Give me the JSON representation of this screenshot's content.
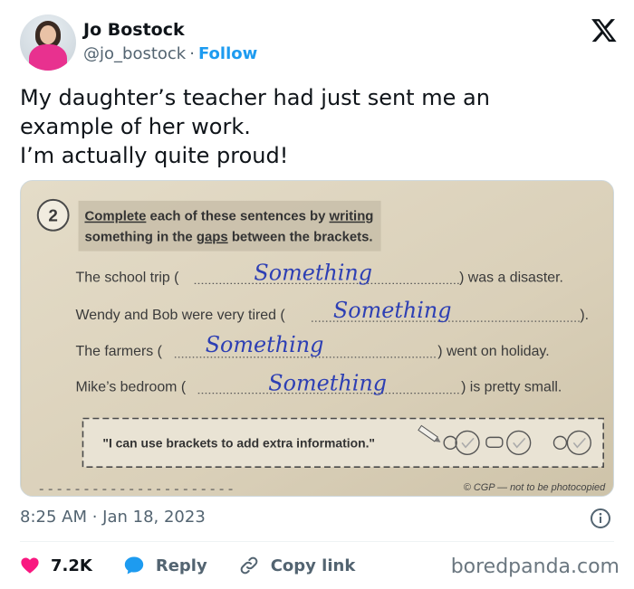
{
  "author": {
    "name": "Jo Bostock",
    "handle": "@jo_bostock",
    "separator": "·",
    "follow_label": "Follow"
  },
  "tweet": {
    "lines": [
      "My daughter’s teacher had just sent me an",
      "example of her work.",
      "I’m actually quite proud!"
    ]
  },
  "worksheet": {
    "number": "2",
    "instruction_line1_a": "Complete",
    "instruction_line1_b": " each of these sentences by ",
    "instruction_line1_c": "writing",
    "instruction_line2_a": "something in the ",
    "instruction_line2_b": "gaps",
    "instruction_line2_c": " between the brackets.",
    "sentences": [
      {
        "before": "The school trip (",
        "fill": "Something",
        "after": ") was a disaster."
      },
      {
        "before": "Wendy and Bob were very tired (",
        "fill": "Something",
        "after": ")."
      },
      {
        "before": "The farmers (",
        "fill": "Something",
        "after": ") went on holiday."
      },
      {
        "before": "Mike’s bedroom (",
        "fill": "Something",
        "after": ") is pretty small."
      }
    ],
    "self_check": "\"I can use brackets to add extra information.\"",
    "copyright": "© CGP — not to be photocopied"
  },
  "meta": {
    "timestamp": "8:25 AM · Jan 18, 2023"
  },
  "actions": {
    "like_count": "7.2K",
    "reply_label": "Reply",
    "copy_label": "Copy link"
  },
  "watermark": "boredpanda.com",
  "colors": {
    "like": "#f91880",
    "reply": "#1d9bf0",
    "follow": "#1d9bf0",
    "handwriting": "#2d3fb4"
  }
}
